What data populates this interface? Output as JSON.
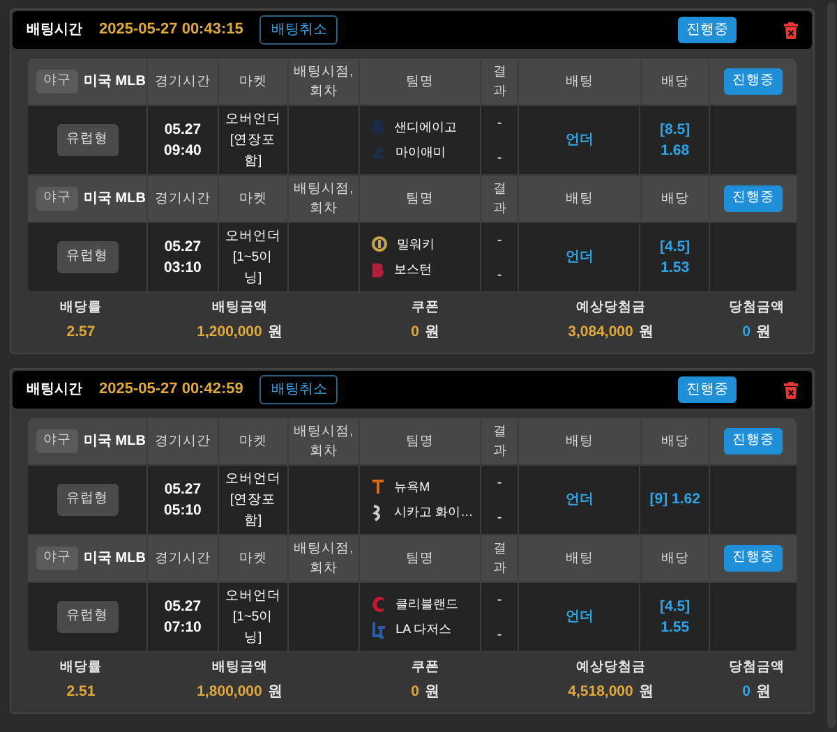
{
  "bets": [
    {
      "time_label": "배팅시간",
      "time": "2025-05-27 00:43:15",
      "cancel_button": "배팅취소",
      "status_button": "진행중",
      "games": [
        {
          "sport_tag": "야구",
          "league": "미국 MLB",
          "columns": [
            "경기시간",
            "마켓",
            "배팅시점, 회차",
            "팀명",
            "결과",
            "배팅",
            "배당"
          ],
          "status_badge": "진행중",
          "bet_type": "유럽형",
          "date": "05.27",
          "time": "09:40",
          "market": "오버언더 [연장포함]",
          "teams": [
            {
              "name": "샌디에이고",
              "result": "-"
            },
            {
              "name": "마이애미",
              "result": "-"
            }
          ],
          "pick": "언더",
          "odds": "[8.5] 1.68"
        },
        {
          "sport_tag": "야구",
          "league": "미국 MLB",
          "columns": [
            "경기시간",
            "마켓",
            "배팅시점, 회차",
            "팀명",
            "결과",
            "배팅",
            "배당"
          ],
          "status_badge": "진행중",
          "bet_type": "유럽형",
          "date": "05.27",
          "time": "03:10",
          "market": "오버언더 [1~5이닝]",
          "teams": [
            {
              "name": "밀워키",
              "result": "-"
            },
            {
              "name": "보스턴",
              "result": "-"
            }
          ],
          "pick": "언더",
          "odds": "[4.5] 1.53"
        }
      ],
      "summary": [
        {
          "label": "배당률",
          "value": "2.57",
          "color": "#e0a93a"
        },
        {
          "label": "배팅금액",
          "value": "1,200,000",
          "unit": "원",
          "color": "#e0a93a"
        },
        {
          "label": "쿠폰",
          "value": "0",
          "unit": "원",
          "color": "#e0a93a"
        },
        {
          "label": "예상당첨금",
          "value": "3,084,000",
          "unit": "원",
          "color": "#e0a93a"
        },
        {
          "label": "당첨금액",
          "value": "0",
          "unit": "원",
          "color": "#2fa3e6"
        }
      ]
    },
    {
      "time_label": "배팅시간",
      "time": "2025-05-27 00:42:59",
      "cancel_button": "배팅취소",
      "status_button": "진행중",
      "games": [
        {
          "sport_tag": "야구",
          "league": "미국 MLB",
          "columns": [
            "경기시간",
            "마켓",
            "배팅시점, 회차",
            "팀명",
            "결과",
            "배팅",
            "배당"
          ],
          "status_badge": "진행중",
          "bet_type": "유럽형",
          "date": "05.27",
          "time": "05:10",
          "market": "오버언더 [연장포함]",
          "teams": [
            {
              "name": "뉴욕M",
              "result": "-"
            },
            {
              "name": "시카고 화이…",
              "result": "-"
            }
          ],
          "pick": "언더",
          "odds": "[9] 1.62"
        },
        {
          "sport_tag": "야구",
          "league": "미국 MLB",
          "columns": [
            "경기시간",
            "마켓",
            "배팅시점, 회차",
            "팀명",
            "결과",
            "배팅",
            "배당"
          ],
          "status_badge": "진행중",
          "bet_type": "유럽형",
          "date": "05.27",
          "time": "07:10",
          "market": "오버언더 [1~5이닝]",
          "teams": [
            {
              "name": "클리블랜드",
              "result": "-"
            },
            {
              "name": "LA 다저스",
              "result": "-"
            }
          ],
          "pick": "언더",
          "odds": "[4.5] 1.55"
        }
      ],
      "summary": [
        {
          "label": "배당률",
          "value": "2.51",
          "color": "#e0a93a"
        },
        {
          "label": "배팅금액",
          "value": "1,800,000",
          "unit": "원",
          "color": "#e0a93a"
        },
        {
          "label": "쿠폰",
          "value": "0",
          "unit": "원",
          "color": "#e0a93a"
        },
        {
          "label": "예상당첨금",
          "value": "4,518,000",
          "unit": "원",
          "color": "#e0a93a"
        },
        {
          "label": "당첨금액",
          "value": "0",
          "unit": "원",
          "color": "#2fa3e6"
        }
      ]
    }
  ]
}
